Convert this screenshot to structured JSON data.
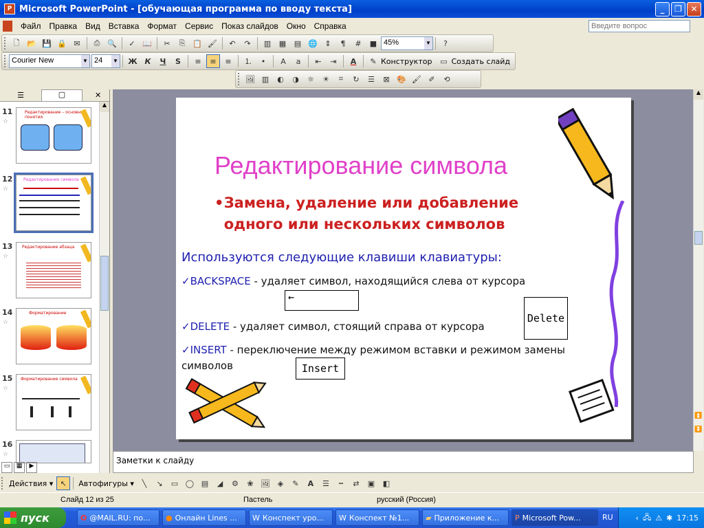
{
  "window": {
    "title": "Microsoft PowerPoint - [обучающая программа по вводу текста]"
  },
  "menu": [
    "Файл",
    "Правка",
    "Вид",
    "Вставка",
    "Формат",
    "Сервис",
    "Показ слайдов",
    "Окно",
    "Справка"
  ],
  "ask_placeholder": "Введите вопрос",
  "toolbar": {
    "zoom": "45%",
    "font": "Courier New",
    "size": "24",
    "bold": "Ж",
    "italic": "К",
    "underline": "Ч",
    "shadow": "S",
    "designer": "Конструктор",
    "new_slide": "Создать слайд"
  },
  "thumbs": {
    "numbers": [
      "11",
      "12",
      "13",
      "14",
      "15",
      "16"
    ],
    "t11": "Редактирование – основные понятия",
    "t12": "Редактирование символа",
    "t13": "Редактирование абзаца",
    "t14": "Форматирование",
    "t15": "Форматирование символа"
  },
  "slide": {
    "title": "Редактирование символа",
    "bullet": "Замена, удаление или добавление одного или нескольких символов",
    "intro": "Используются следующие клавиши клавиатуры:",
    "items": [
      {
        "key": "BACKSPACE",
        "desc": " - удаляет символ, находящийся слева от курсора"
      },
      {
        "key": "DELETE",
        "desc": " - удаляет символ, стоящий справа от курсора"
      },
      {
        "key": "INSERT",
        "desc": " - переключение между режимом вставки и режимом замены символов"
      }
    ],
    "keys": {
      "delete": "Delete",
      "insert": "Insert",
      "backspace_arrow": "←"
    }
  },
  "notes_placeholder": "Заметки к слайду",
  "drawing": {
    "actions": "Действия",
    "autoshapes": "Автофигуры"
  },
  "status": {
    "slide": "Слайд 12 из 25",
    "design": "Пастель",
    "lang": "русский (Россия)"
  },
  "taskbar": {
    "start": "пуск",
    "tasks": [
      "@MAIL.RU: по...",
      "Онлайн Lines ...",
      "Конспект уро...",
      "Конспект №1...",
      "Приложение к...",
      "Microsoft Pow..."
    ],
    "lang": "RU",
    "time": "17:15"
  },
  "colors": {
    "title": "#e040c8",
    "bullet": "#cc2020",
    "text": "#2020b0"
  }
}
